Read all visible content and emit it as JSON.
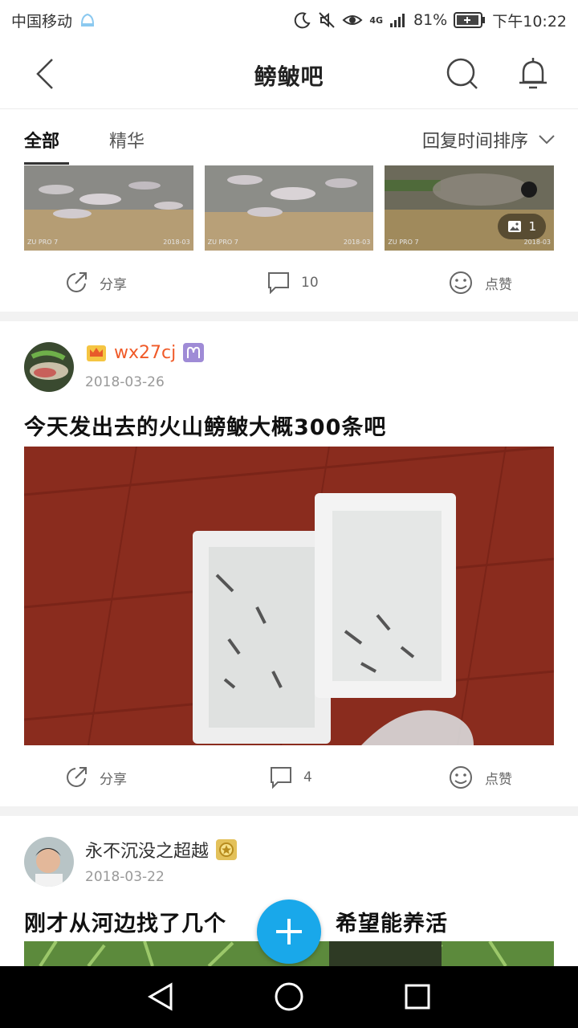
{
  "status_bar": {
    "carrier": "中国移动",
    "network": "4G",
    "battery": "81%",
    "time": "下午10:22"
  },
  "nav": {
    "title": "鳑鲏吧"
  },
  "tabs": {
    "items": [
      "全部",
      "精华"
    ],
    "sort_label": "回复时间排序"
  },
  "top_post": {
    "image_count_badge": "1",
    "watermarks": [
      "ZU PRO 7",
      "ZU PRO 7",
      "ZU PRO 7"
    ],
    "thumb_dates": [
      "2018-03",
      "2018-03",
      "2018-03"
    ],
    "share_label": "分享",
    "comment_count": "10",
    "like_label": "点赞"
  },
  "posts": [
    {
      "username": "wx27cj",
      "date": "2018-03-26",
      "title": "今天发出去的火山鳑鲏大概300条吧",
      "share_label": "分享",
      "comment_count": "4",
      "like_label": "点赞"
    },
    {
      "username": "永不沉没之超越",
      "date": "2018-03-22",
      "title_left": "刚才从河边找了几个",
      "title_right": "希望能养活"
    }
  ],
  "colors": {
    "accent": "#19a8ea",
    "username_vip": "#f05a28",
    "divider": "#f2f2f2"
  }
}
